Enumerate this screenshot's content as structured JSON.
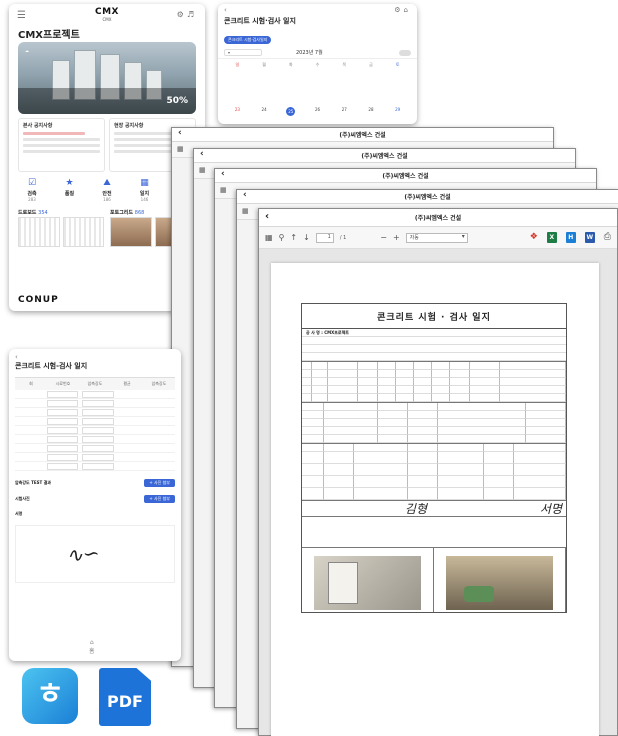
{
  "dashboard": {
    "brand": "CMX",
    "brand_sub": "CMX",
    "project_title": "CMX프로젝트",
    "progress": "50%",
    "notice_title": "본사 공지사항",
    "site_notice_title": "현장 공지사항",
    "stats": [
      {
        "label": "검측",
        "count": "283"
      },
      {
        "label": "품질",
        "count": ""
      },
      {
        "label": "안전",
        "count": "186"
      },
      {
        "label": "일지",
        "count": "146"
      },
      {
        "label": "그리",
        "count": ""
      }
    ],
    "drawings_label": "드로보드",
    "drawings_count": "354",
    "photos_label": "포토그리드",
    "photos_count": "868",
    "footer_logo": "CONUP"
  },
  "calendar": {
    "title": "콘크리트 시험·검사 일지",
    "chip": "콘크리트 시험·검사일지",
    "month": "2023년 7월",
    "weekdays": [
      "일",
      "월",
      "화",
      "수",
      "목",
      "금",
      "토"
    ],
    "days": [
      "23",
      "24",
      "25",
      "26",
      "27",
      "28",
      "29"
    ],
    "selected_day": "25"
  },
  "list": {
    "title": "콘크리트 시험-검사 일지",
    "headers": [
      "회",
      "시료번호",
      "압축강도",
      "평균",
      "압축강도"
    ],
    "section1": "압축강도 TEST 결과",
    "section2": "시험사진",
    "section3": "서명",
    "btn": "+ 사진 첨부",
    "home": "홈"
  },
  "viewer": {
    "window_title": "(주)씨엠엑스 건설",
    "page_current": "1",
    "page_total": "/ 1",
    "zoom": "자동"
  },
  "report": {
    "title": "콘크리트 시험 · 검사 일지",
    "company": "공 사 명 : CMX프로젝트",
    "sign": "김형",
    "sign2": "서명"
  }
}
